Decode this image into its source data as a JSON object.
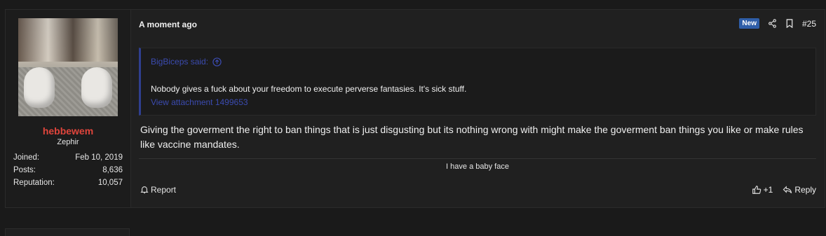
{
  "user": {
    "name": "hebbewem",
    "title": "Zephir",
    "stats": [
      {
        "label": "Joined:",
        "value": "Feb 10, 2019"
      },
      {
        "label": "Posts:",
        "value": "8,636"
      },
      {
        "label": "Reputation:",
        "value": "10,057"
      }
    ],
    "avatar_icon": "avatar-photo"
  },
  "post": {
    "time": "A moment ago",
    "badge": "New",
    "number": "#25",
    "quote": {
      "author": "BigBiceps said:",
      "text": "Nobody gives a fuck about your freedom to execute perverse fantasies. It's sick stuff.",
      "attachment": "View attachment 1499653"
    },
    "message": "Giving the goverment the right to ban things that is just disgusting but its nothing wrong with might make the goverment ban things you like or make rules like vaccine mandates.",
    "signature": "I have a baby face",
    "report_label": "Report",
    "like_count": "+1",
    "reply_label": "Reply"
  },
  "colors": {
    "background": "#1a1a1a",
    "panel": "#202020",
    "username": "#e0453c",
    "quote_accent": "#2f3f8f",
    "badge_new": "#2f5ea8"
  }
}
